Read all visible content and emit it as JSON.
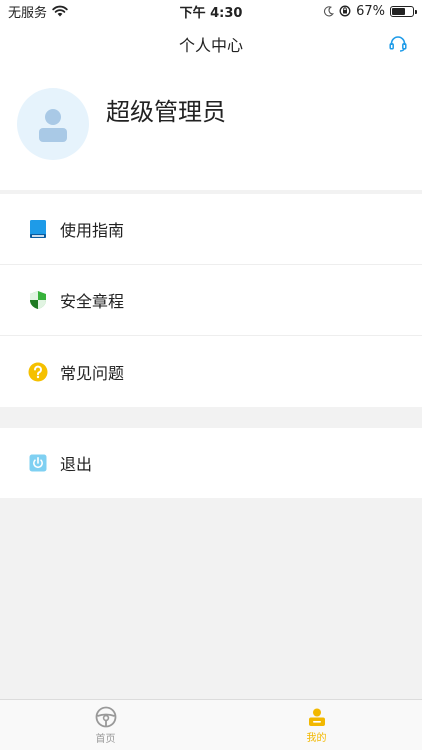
{
  "status_bar": {
    "carrier": "无服务",
    "time": "下午 4:30",
    "battery_percent": "67%",
    "battery_level": 0.67
  },
  "navbar": {
    "title": "个人中心",
    "right_icon": "headset-icon"
  },
  "profile": {
    "username": "超级管理员",
    "avatar_icon": "user-avatar-icon"
  },
  "menu": {
    "items": [
      {
        "label": "使用指南",
        "icon": "book-icon",
        "color": "#1e9be8"
      },
      {
        "label": "安全章程",
        "icon": "shield-icon",
        "color": "#38b23c"
      },
      {
        "label": "常见问题",
        "icon": "question-icon",
        "color": "#f5c000"
      }
    ]
  },
  "logout": {
    "label": "退出",
    "icon": "power-icon",
    "color": "#7fd0f2"
  },
  "tabbar": {
    "tabs": [
      {
        "label": "首页",
        "icon": "steering-wheel-icon",
        "active": false
      },
      {
        "label": "我的",
        "icon": "user-badge-icon",
        "active": true
      }
    ],
    "active_color": "#f2b800"
  }
}
